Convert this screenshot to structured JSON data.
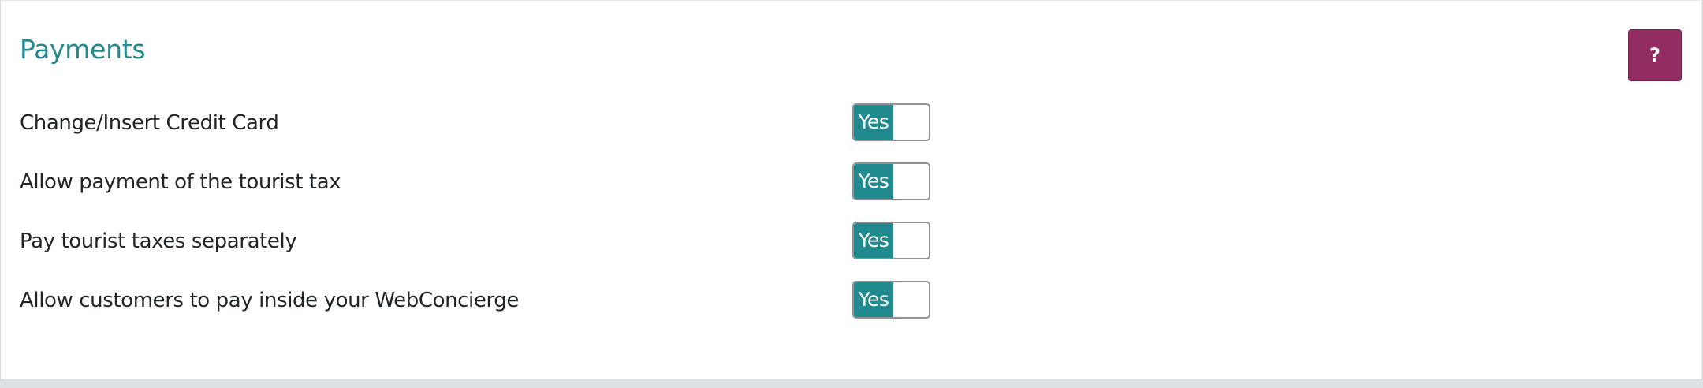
{
  "section": {
    "title": "Payments",
    "help_label": "?"
  },
  "settings": [
    {
      "label": "Change/Insert Credit Card",
      "value": "Yes"
    },
    {
      "label": "Allow payment of the tourist tax",
      "value": "Yes"
    },
    {
      "label": "Pay tourist taxes separately",
      "value": "Yes"
    },
    {
      "label": "Allow customers to pay inside your WebConcierge",
      "value": "Yes"
    }
  ],
  "colors": {
    "accent": "#208a8f",
    "help_button": "#922c62"
  }
}
